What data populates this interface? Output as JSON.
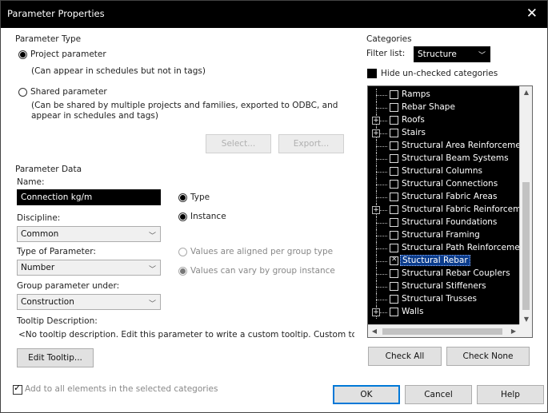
{
  "window": {
    "title": "Parameter Properties",
    "close_glyph": "✕"
  },
  "parameter_type": {
    "heading": "Parameter Type",
    "project_label": "Project parameter",
    "project_note": "(Can appear in schedules but not in tags)",
    "shared_label": "Shared parameter",
    "shared_note_1": "(Can be shared by multiple projects and families, exported to ODBC, and",
    "shared_note_2": "appear in schedules and tags)",
    "select_button": "Select...",
    "export_button": "Export..."
  },
  "parameter_data": {
    "heading": "Parameter Data",
    "name_label": "Name:",
    "name_value": "Connection kg/m",
    "type_label": "Type",
    "instance_label": "Instance",
    "discipline_label": "Discipline:",
    "discipline_value": "Common",
    "type_of_parameter_label": "Type of Parameter:",
    "type_of_parameter_value": "Number",
    "group_label": "Group parameter under:",
    "group_value": "Construction",
    "aligned_label": "Values are aligned per group type",
    "vary_label": "Values can vary by group instance",
    "tooltip_heading": "Tooltip Description:",
    "tooltip_text": "<No tooltip description. Edit this parameter to write a custom tooltip. Custom tooltips ha...",
    "edit_tooltip_button": "Edit Tooltip..."
  },
  "categories": {
    "heading": "Categories",
    "filter_label": "Filter list:",
    "filter_value": "Structure",
    "hide_unchecked_label": "Hide un-checked categories",
    "items": [
      {
        "label": "Ramps",
        "expandable": false,
        "checked": false,
        "selected": false
      },
      {
        "label": "Rebar Shape",
        "expandable": false,
        "checked": false,
        "selected": false
      },
      {
        "label": "Roofs",
        "expandable": true,
        "checked": false,
        "selected": false
      },
      {
        "label": "Stairs",
        "expandable": true,
        "checked": false,
        "selected": false
      },
      {
        "label": "Structural Area Reinforcement",
        "expandable": false,
        "checked": false,
        "selected": false
      },
      {
        "label": "Structural Beam Systems",
        "expandable": false,
        "checked": false,
        "selected": false
      },
      {
        "label": "Structural Columns",
        "expandable": false,
        "checked": false,
        "selected": false
      },
      {
        "label": "Structural Connections",
        "expandable": false,
        "checked": false,
        "selected": false
      },
      {
        "label": "Structural Fabric Areas",
        "expandable": false,
        "checked": false,
        "selected": false
      },
      {
        "label": "Structural Fabric Reinforcement",
        "expandable": true,
        "checked": false,
        "selected": false
      },
      {
        "label": "Structural Foundations",
        "expandable": false,
        "checked": false,
        "selected": false
      },
      {
        "label": "Structural Framing",
        "expandable": false,
        "checked": false,
        "selected": false
      },
      {
        "label": "Structural Path Reinforcement",
        "expandable": false,
        "checked": false,
        "selected": false
      },
      {
        "label": "Stuctural Rebar",
        "expandable": false,
        "checked": true,
        "selected": true
      },
      {
        "label": "Structural Rebar Couplers",
        "expandable": false,
        "checked": false,
        "selected": false
      },
      {
        "label": "Structural Stiffeners",
        "expandable": false,
        "checked": false,
        "selected": false
      },
      {
        "label": "Structural Trusses",
        "expandable": false,
        "checked": false,
        "selected": false
      },
      {
        "label": "Walls",
        "expandable": true,
        "checked": false,
        "selected": false
      }
    ],
    "check_all_button": "Check All",
    "check_none_button": "Check None"
  },
  "footer": {
    "add_to_all_label": "Add to all elements in the selected categories",
    "ok_button": "OK",
    "cancel_button": "Cancel",
    "help_button": "Help"
  }
}
